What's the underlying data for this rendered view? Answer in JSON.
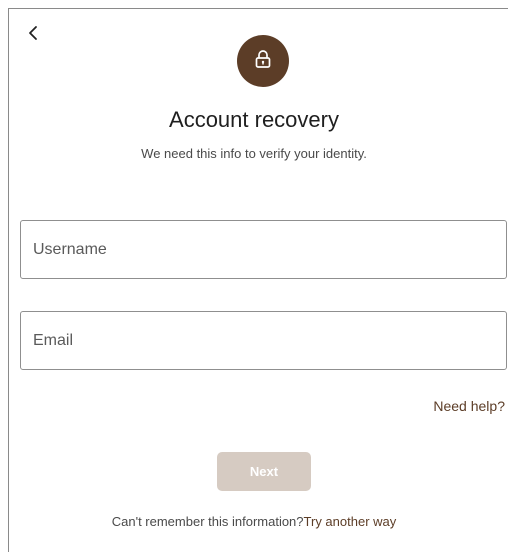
{
  "header": {
    "back_icon": "chevron-left-icon",
    "badge_icon": "lock-icon",
    "badge_color": "#5c3d27"
  },
  "main": {
    "title": "Account recovery",
    "subtitle": "We need this info to verify your identity."
  },
  "form": {
    "username_placeholder": "Username",
    "email_placeholder": "Email",
    "help_link": "Need help?",
    "next_label": "Next"
  },
  "footer": {
    "prompt": "Can't remember this information?",
    "alternative_link": "Try another way"
  },
  "colors": {
    "accent": "#5c3d27",
    "button_disabled": "#d6cbc2"
  }
}
